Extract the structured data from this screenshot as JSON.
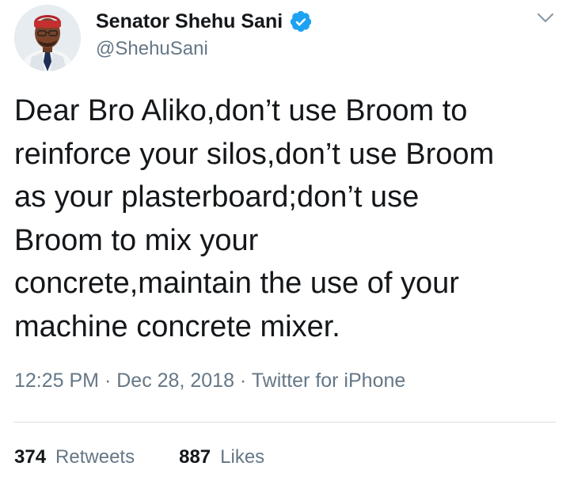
{
  "author": {
    "display_name": "Senator Shehu Sani",
    "handle": "@ShehuSani",
    "verified": true,
    "avatar_icon": "profile-photo-icon"
  },
  "tweet": {
    "text": "Dear Bro Aliko,don’t use Broom to\nreinforce your silos,don’t use Broom\nas your plasterboard;don’t use\nBroom to mix your\nconcrete,maintain the use of your\nmachine concrete mixer."
  },
  "meta": {
    "time": "12:25 PM",
    "separator": "·",
    "date": "Dec 28, 2018",
    "source": "Twitter for iPhone"
  },
  "stats": {
    "retweets_count": "374",
    "retweets_label": "Retweets",
    "likes_count": "887",
    "likes_label": "Likes"
  },
  "colors": {
    "verified_blue": "#1da1f2",
    "secondary_text": "#657786",
    "primary_text": "#14171a",
    "divider": "#d7dde2"
  }
}
